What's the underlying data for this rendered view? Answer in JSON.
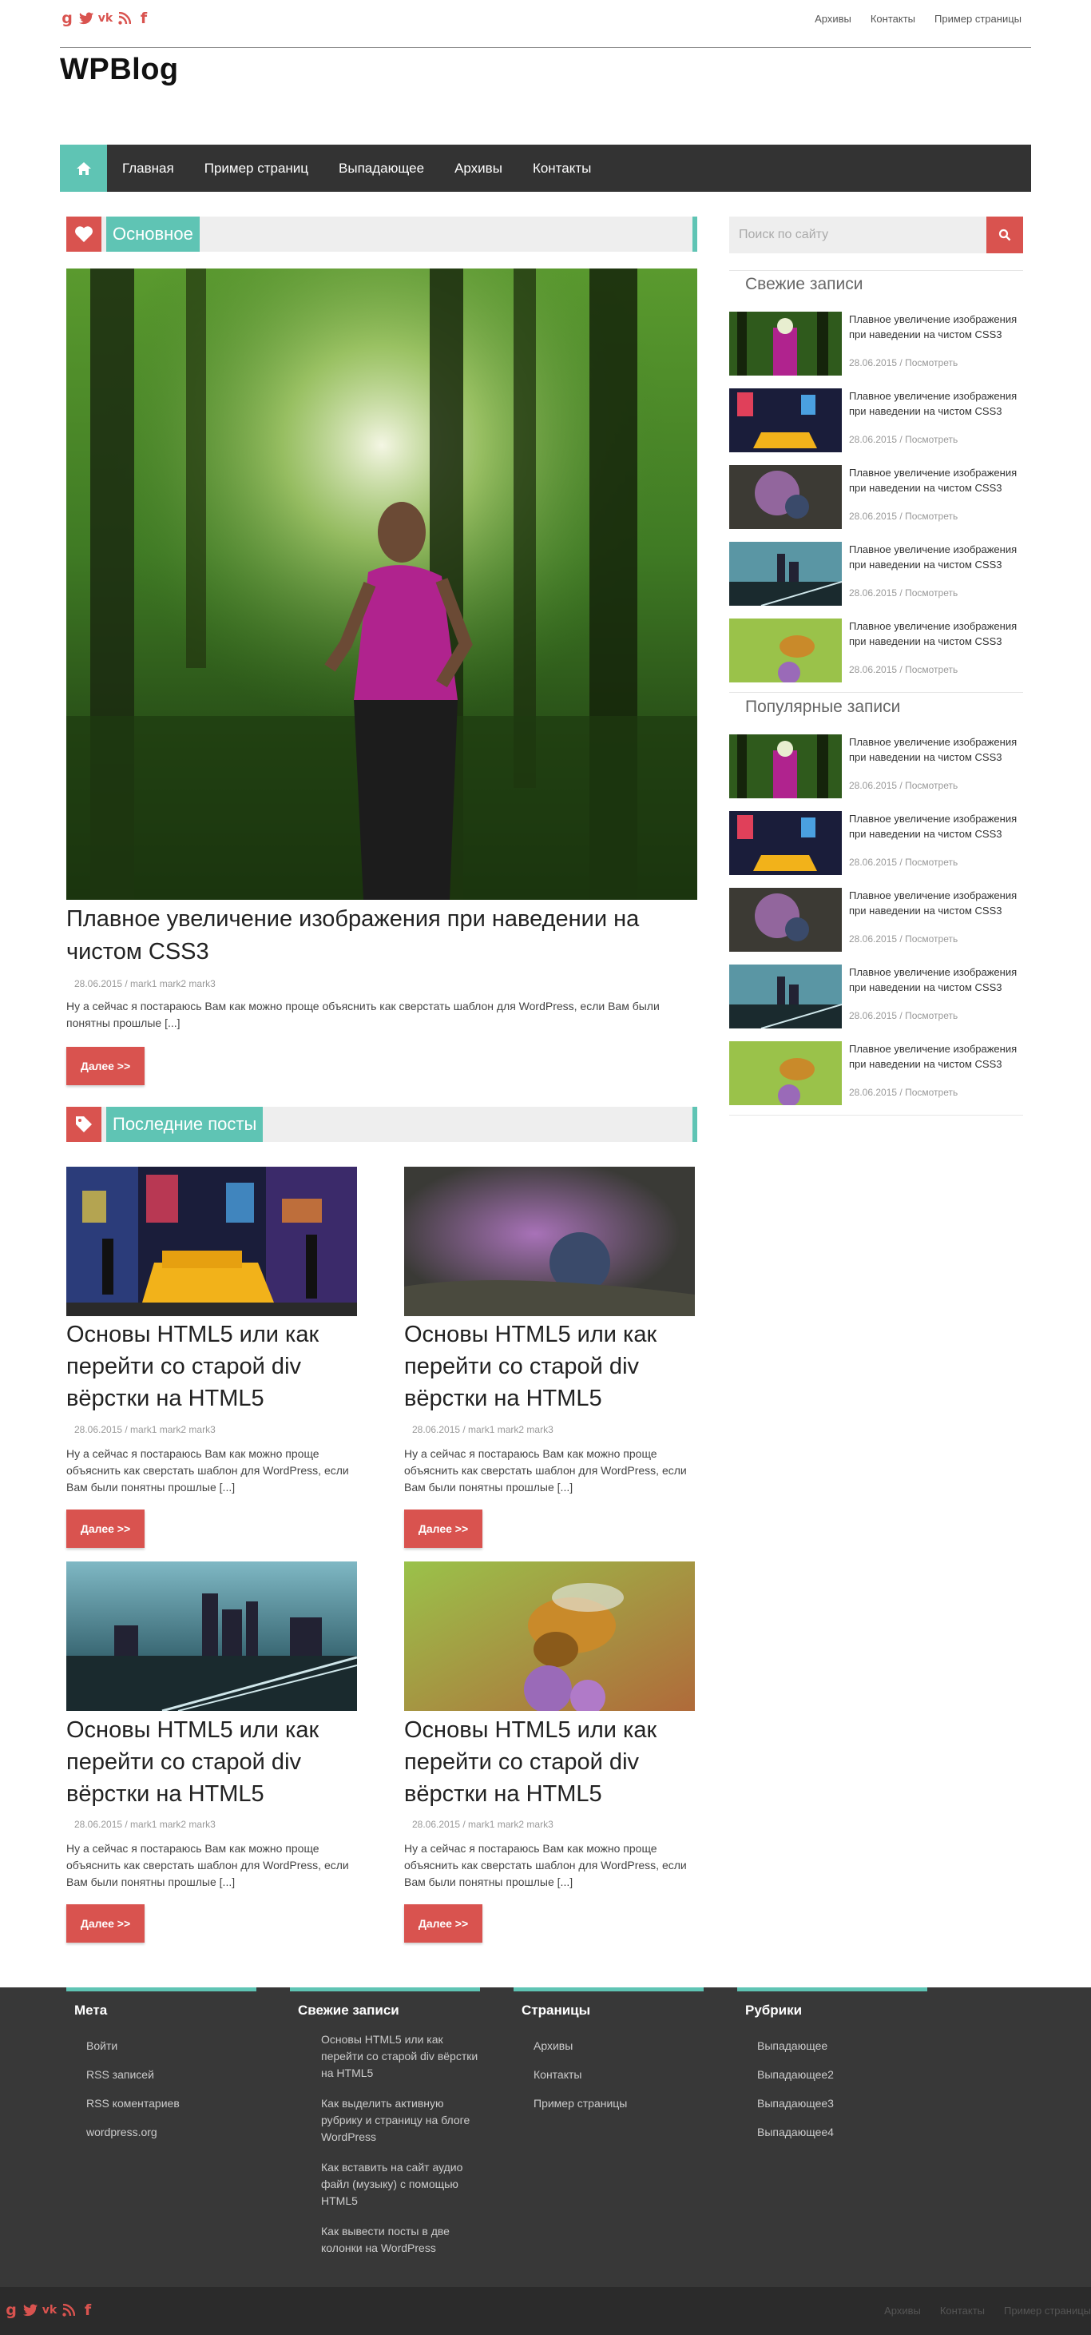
{
  "site": {
    "title": "WPBlog"
  },
  "top_links": [
    "Архивы",
    "Контакты",
    "Пример страницы"
  ],
  "nav": {
    "items": [
      "Главная",
      "Пример страниц",
      "Выпадающее",
      "Архивы",
      "Контакты"
    ]
  },
  "sections": {
    "featured": "Основное",
    "latest": "Последние посты"
  },
  "featured_post": {
    "title": "Плавное увеличение изображения при наведении на чистом CSS3",
    "meta": "28.06.2015 / mark1 mark2 mark3",
    "excerpt": "Ну а сейчас я постараюсь Вам как можно проще объяснить как сверстать шаблон для WordPress, если Вам были понятны прошлые [...]",
    "more": "Далее >>"
  },
  "posts": [
    {
      "title": "Основы HTML5 или как перейти со старой div вёрстки на HTML5",
      "meta": "28.06.2015 / mark1 mark2 mark3",
      "excerpt": "Ну а сейчас я постараюсь Вам как можно проще объяснить как сверстать шаблон для WordPress, если Вам были понятны прошлые [...]",
      "more": "Далее >>"
    },
    {
      "title": "Основы HTML5 или как перейти со старой div вёрстки на HTML5",
      "meta": "28.06.2015 / mark1 mark2 mark3",
      "excerpt": "Ну а сейчас я постараюсь Вам как можно проще объяснить как сверстать шаблон для WordPress, если Вам были понятны прошлые [...]",
      "more": "Далее >>"
    },
    {
      "title": "Основы HTML5 или как перейти со старой div вёрстки на HTML5",
      "meta": "28.06.2015 / mark1 mark2 mark3",
      "excerpt": "Ну а сейчас я постараюсь Вам как можно проще объяснить как сверстать шаблон для WordPress, если Вам были понятны прошлые [...]",
      "more": "Далее >>"
    },
    {
      "title": "Основы HTML5 или как перейти со старой div вёрстки на HTML5",
      "meta": "28.06.2015 / mark1 mark2 mark3",
      "excerpt": "Ну а сейчас я постараюсь Вам как можно проще объяснить как сверстать шаблон для WordPress, если Вам были понятны прошлые [...]",
      "more": "Далее >>"
    }
  ],
  "sidebar": {
    "search_placeholder": "Поиск по сайту",
    "recent_title": "Свежие записи",
    "popular_title": "Популярные записи",
    "item_title": "Плавное увеличение изображения при наведении на чистом CSS3",
    "item_date": "28.06.2015",
    "item_link": "Посмотреть"
  },
  "footer": {
    "meta": {
      "title": "Мета",
      "items": [
        "Войти",
        "RSS записей",
        "RSS коментариев",
        "wordpress.org"
      ]
    },
    "recent": {
      "title": "Свежие записи",
      "items": [
        "Основы HTML5 или как перейти со старой div вёрстки на HTML5",
        "Как выделить активную рубрику и страницу на блоге WordPress",
        "Как вставить на сайт аудио файл (музыку) с помощью HTML5",
        "Как вывести посты в две колонки на WordPress"
      ]
    },
    "pages": {
      "title": "Страницы",
      "items": [
        "Архивы",
        "Контакты",
        "Пример страницы"
      ]
    },
    "rubrics": {
      "title": "Рубрики",
      "items": [
        "Выпадающее",
        "Выпадающее2",
        "Выпадающее3",
        "Выпадающее4"
      ]
    }
  },
  "icons": {
    "social": [
      "google-plus-icon",
      "twitter-icon",
      "vk-icon",
      "rss-icon",
      "facebook-icon"
    ],
    "social_glyphs": [
      "g",
      "t",
      "vk",
      "rss",
      "f"
    ]
  },
  "colors": {
    "accent_red": "#d9534f",
    "accent_teal": "#5fc4b4",
    "nav_bg": "#333333",
    "footer_bg": "#383838"
  }
}
